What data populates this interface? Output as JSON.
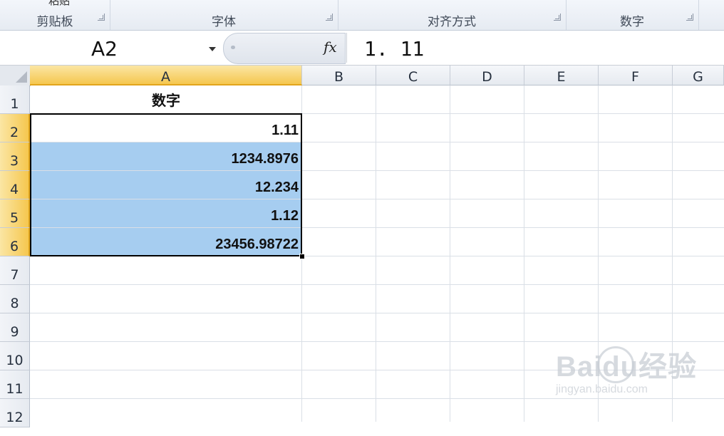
{
  "ribbon": {
    "top_fragment": "粘贴",
    "groups": [
      {
        "label": "剪贴板"
      },
      {
        "label": "字体"
      },
      {
        "label": "对齐方式"
      },
      {
        "label": "数字"
      }
    ]
  },
  "formula_bar": {
    "name_box": "A2",
    "fx_label": "fx",
    "content": "1. 11"
  },
  "sheet": {
    "columns": [
      "A",
      "B",
      "C",
      "D",
      "E",
      "F",
      "G"
    ],
    "rows": [
      "1",
      "2",
      "3",
      "4",
      "5",
      "6",
      "7",
      "8",
      "9",
      "10",
      "11",
      "12"
    ],
    "selected_column": "A",
    "cells": {
      "a1": "数字",
      "a2": "1.11",
      "a3": "1234.8976",
      "a4": "12.234",
      "a5": "1.12",
      "a6": "23456.98722"
    },
    "highlight_color": "#a6cdf0",
    "header_selected_color": "#f5c74f"
  },
  "watermark": {
    "brand": "Baidu经验",
    "url": "jingyan.baidu.com"
  }
}
